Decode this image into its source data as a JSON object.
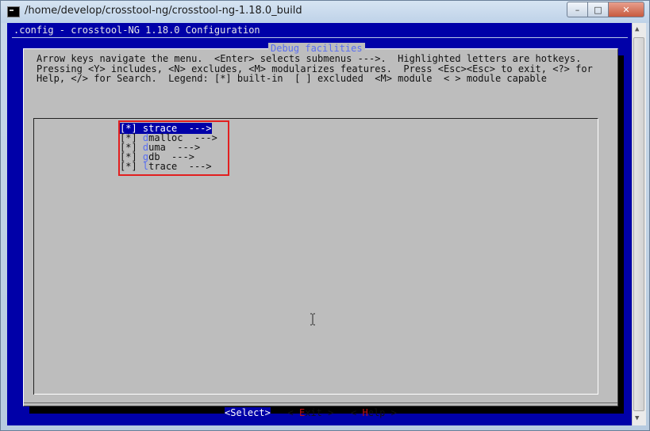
{
  "window": {
    "title": "/home/develop/crosstool-ng/crosstool-ng-1.18.0_build",
    "buttons": {
      "minimize": "–",
      "maximize": "□",
      "close": "✕"
    }
  },
  "terminal": {
    "header": ".config - crosstool-NG 1.18.0 Configuration",
    "dialog": {
      "title": "Debug facilities",
      "help_lines": [
        "Arrow keys navigate the menu.  <Enter> selects submenus --->.  Highlighted letters are hotkeys.",
        "Pressing <Y> includes, <N> excludes, <M> modularizes features.  Press <Esc><Esc> to exit, <?> for",
        "Help, </> for Search.  Legend: [*] built-in  [ ] excluded  <M> module  < > module capable"
      ],
      "menu_items": [
        {
          "check": "[*]",
          "hotkey": "s",
          "rest": "trace  --->",
          "selected": true
        },
        {
          "check": "[*]",
          "hotkey": "d",
          "rest": "malloc  --->",
          "selected": false
        },
        {
          "check": "[*]",
          "hotkey": "d",
          "rest": "uma  --->",
          "selected": false
        },
        {
          "check": "[*]",
          "hotkey": "g",
          "rest": "db  --->",
          "selected": false
        },
        {
          "check": "[*]",
          "hotkey": "l",
          "rest": "trace  --->",
          "selected": false
        }
      ],
      "buttons": {
        "select": {
          "open": "<",
          "hotkey": "S",
          "rest": "elect",
          "close": ">"
        },
        "exit": {
          "open": "< ",
          "hotkey": "E",
          "rest": "xit",
          "close": " >"
        },
        "help": {
          "open": "< ",
          "hotkey": "H",
          "rest": "elp",
          "close": " >"
        }
      }
    }
  },
  "colors": {
    "terminal_bg": "#0000a8",
    "dialog_bg": "#bdbdbd",
    "highlight": "#0000a8",
    "hotkey_blue": "#5a6ff0",
    "hotkey_red": "#c01010",
    "annotation_red": "#e21f1f"
  },
  "icons": {
    "app": "terminal-icon",
    "cursor": "i-beam-cursor-icon"
  }
}
